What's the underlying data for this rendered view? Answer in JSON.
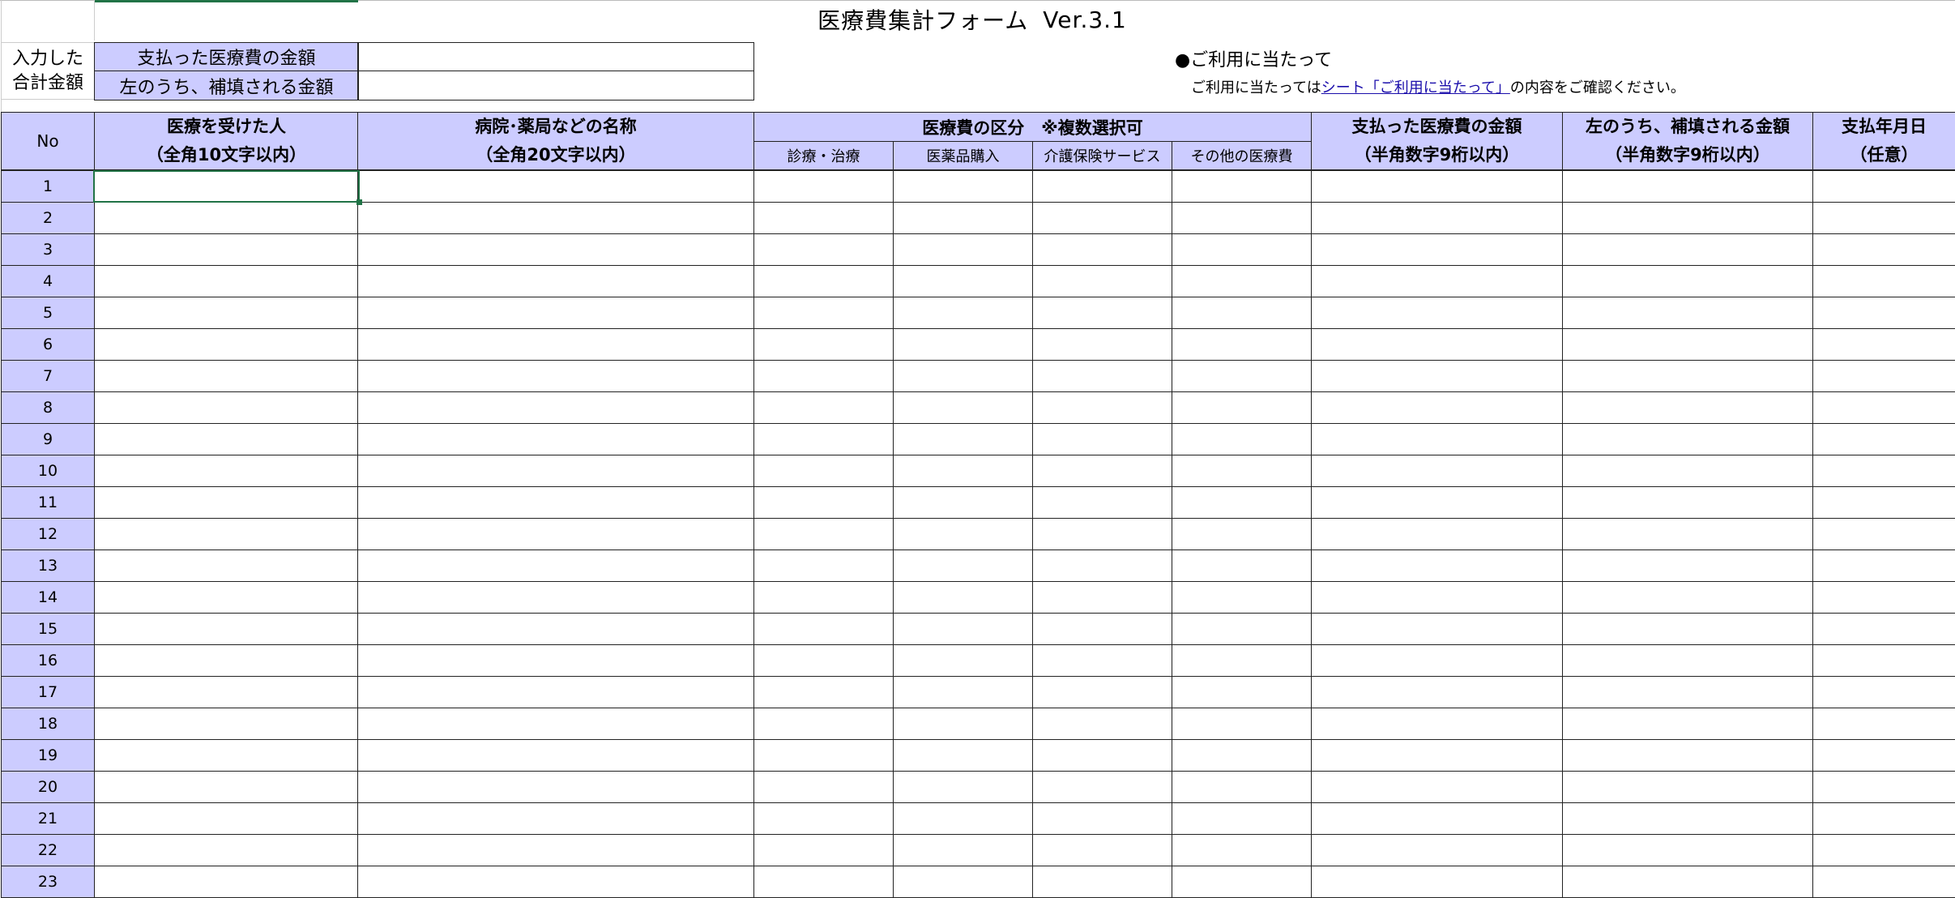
{
  "form_title": "医療費集計フォーム",
  "form_version": "Ver.3.1",
  "totals": {
    "side_label_line1": "入力した",
    "side_label_line2": "合計金額",
    "paid_label": "支払った医療費の金額",
    "paid_value": "",
    "reimbursed_label": "左のうち、補填される金額",
    "reimbursed_value": ""
  },
  "notice": {
    "heading": "●ご利用に当たって",
    "text_before": "ご利用に当たっては",
    "link_text": "シート「ご利用に当たって」",
    "text_after": "の内容をご確認ください。"
  },
  "table": {
    "col_no": "No",
    "col_person_line1": "医療を受けた人",
    "col_person_line2": "（全角10文字以内）",
    "col_facility_line1": "病院･薬局などの名称",
    "col_facility_line2": "（全角20文字以内）",
    "col_category": "医療費の区分　※複数選択可",
    "sub_treatment": "診療・治療",
    "sub_medicine": "医薬品購入",
    "sub_care": "介護保険サービス",
    "sub_other": "その他の医療費",
    "col_paid_line1": "支払った医療費の金額",
    "col_paid_line2": "（半角数字9桁以内）",
    "col_reimbursed_line1": "左のうち、補填される金額",
    "col_reimbursed_line2": "（半角数字9桁以内）",
    "col_date_line1": "支払年月日",
    "col_date_line2": "（任意）",
    "row_numbers": [
      "1",
      "2",
      "3",
      "4",
      "5",
      "6",
      "7",
      "8",
      "9",
      "10",
      "11",
      "12",
      "13",
      "14",
      "15",
      "16",
      "17",
      "18",
      "19",
      "20",
      "21",
      "22",
      "23"
    ]
  },
  "colors": {
    "header_fill": "#ccccff",
    "grid_line": "#222222",
    "selection": "#217346",
    "link": "#1a0dab"
  }
}
